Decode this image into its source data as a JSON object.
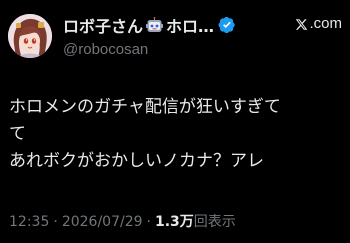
{
  "author": {
    "display_name_prefix": "ロボ子さん",
    "display_name_suffix": "ホロ…",
    "handle": "@robocosan",
    "verified": true,
    "badge_icon": "robot-face-icon",
    "verified_icon": "verified-badge-icon"
  },
  "source": {
    "icon": "x-logo-icon",
    "domain": ".com"
  },
  "tweet": {
    "lines": [
      "ホロメンのガチャ配信が狂いすぎて",
      "て",
      "あれボクがおかしいノカナ？アレ"
    ]
  },
  "meta": {
    "time": "12:35",
    "separator": "·",
    "date": "2026/07/29",
    "separator2": "·",
    "views_count": "1.3万",
    "views_label": "回表示"
  },
  "colors": {
    "background": "#000000",
    "text": "#e7e9ea",
    "muted": "#71767b",
    "verified": "#1d9bf0"
  }
}
